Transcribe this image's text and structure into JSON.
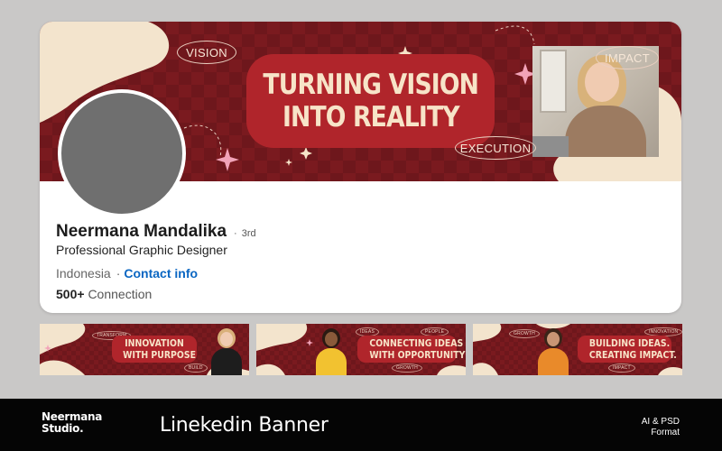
{
  "banner": {
    "headline_line1": "TURNING VISION",
    "headline_line2": "INTO REALITY",
    "pill_vision": "VISION",
    "pill_impact": "IMPACT",
    "pill_execution": "EXECUTION"
  },
  "profile": {
    "name": "Neermana Mandalika",
    "degree_separator": "·",
    "degree": "3rd",
    "title": "Professional Graphic Designer",
    "location": "Indonesia",
    "location_separator": "·",
    "contact_link": "Contact info",
    "connections_count": "500+",
    "connections_label": "Connection"
  },
  "thumbnails": [
    {
      "headline_line1": "INNOVATION",
      "headline_line2": "WITH PURPOSE",
      "pill_top": "TRANSFORM",
      "pill_bottom": "BUILD"
    },
    {
      "headline_line1": "CONNECTING IDEAS",
      "headline_line2": "WITH OPPORTUNITY",
      "pill_left": "IDEAS",
      "pill_right": "PEOPLE",
      "pill_bottom": "GROWTH"
    },
    {
      "headline_line1": "BUILDING IDEAS.",
      "headline_line2": "CREATING IMPACT.",
      "pill_left": "GROWTH",
      "pill_right": "INNOVATION",
      "pill_bottom": "IMPACT"
    }
  ],
  "footer": {
    "brand_line1": "Neermana",
    "brand_line2": "Studio.",
    "product_title": "Linekedin Banner",
    "format_line1": "AI & PSD",
    "format_line2": "Format"
  },
  "colors": {
    "banner_maroon": "#7a1a1f",
    "headline_red": "#b0252b",
    "cream": "#f3e4cd",
    "link_blue": "#0a66c2",
    "footer_black": "#050505"
  },
  "icons": [
    "sparkle-icon",
    "avatar-placeholder"
  ]
}
